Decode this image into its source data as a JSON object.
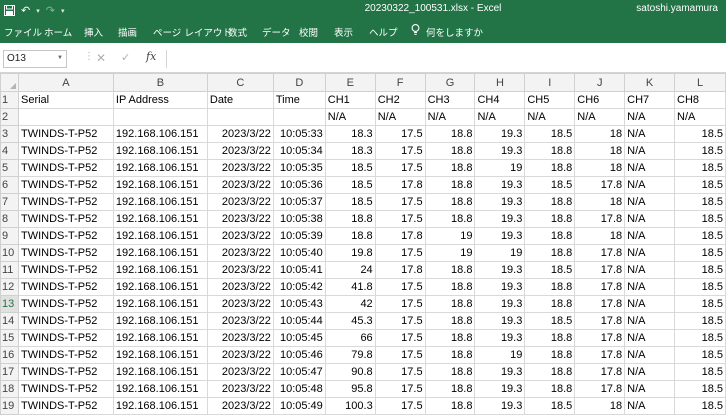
{
  "titlebar": {
    "file_title": "20230322_100531.xlsx - Excel",
    "user": "satoshi.yamamura"
  },
  "ribbon": {
    "tabs": [
      "ファイル",
      "ホーム",
      "挿入",
      "描画",
      "ページ レイアウト",
      "数式",
      "データ",
      "校閲",
      "表示",
      "ヘルプ"
    ],
    "tell_me": "何をしますか"
  },
  "formula_bar": {
    "name_box": "O13",
    "fx_label": "fx",
    "formula": ""
  },
  "sheet": {
    "active_row": "13",
    "columns": [
      "A",
      "B",
      "C",
      "D",
      "E",
      "F",
      "G",
      "H",
      "I",
      "J",
      "K",
      "L"
    ],
    "header_row": [
      "Serial",
      "IP Address",
      "Date",
      "Time",
      "CH1",
      "CH2",
      "CH3",
      "CH4",
      "CH5",
      "CH6",
      "CH7",
      "CH8"
    ],
    "unit_row": [
      "",
      "",
      "",
      "",
      "N/A",
      "N/A",
      "N/A",
      "N/A",
      "N/A",
      "N/A",
      "N/A",
      "N/A"
    ],
    "rows": [
      [
        "3",
        "TWINDS-T-P52",
        "192.168.106.151",
        "2023/3/22",
        "10:05:33",
        "18.3",
        "17.5",
        "18.8",
        "19.3",
        "18.5",
        "18",
        "N/A",
        "18.5"
      ],
      [
        "4",
        "TWINDS-T-P52",
        "192.168.106.151",
        "2023/3/22",
        "10:05:34",
        "18.3",
        "17.5",
        "18.8",
        "19.3",
        "18.8",
        "18",
        "N/A",
        "18.5"
      ],
      [
        "5",
        "TWINDS-T-P52",
        "192.168.106.151",
        "2023/3/22",
        "10:05:35",
        "18.5",
        "17.5",
        "18.8",
        "19",
        "18.8",
        "18",
        "N/A",
        "18.5"
      ],
      [
        "6",
        "TWINDS-T-P52",
        "192.168.106.151",
        "2023/3/22",
        "10:05:36",
        "18.5",
        "17.8",
        "18.8",
        "19.3",
        "18.5",
        "17.8",
        "N/A",
        "18.5"
      ],
      [
        "7",
        "TWINDS-T-P52",
        "192.168.106.151",
        "2023/3/22",
        "10:05:37",
        "18.5",
        "17.5",
        "18.8",
        "19.3",
        "18.8",
        "18",
        "N/A",
        "18.5"
      ],
      [
        "8",
        "TWINDS-T-P52",
        "192.168.106.151",
        "2023/3/22",
        "10:05:38",
        "18.8",
        "17.5",
        "18.8",
        "19.3",
        "18.8",
        "17.8",
        "N/A",
        "18.5"
      ],
      [
        "9",
        "TWINDS-T-P52",
        "192.168.106.151",
        "2023/3/22",
        "10:05:39",
        "18.8",
        "17.8",
        "19",
        "19.3",
        "18.8",
        "18",
        "N/A",
        "18.5"
      ],
      [
        "10",
        "TWINDS-T-P52",
        "192.168.106.151",
        "2023/3/22",
        "10:05:40",
        "19.8",
        "17.5",
        "19",
        "19",
        "18.8",
        "17.8",
        "N/A",
        "18.5"
      ],
      [
        "11",
        "TWINDS-T-P52",
        "192.168.106.151",
        "2023/3/22",
        "10:05:41",
        "24",
        "17.8",
        "18.8",
        "19.3",
        "18.5",
        "17.8",
        "N/A",
        "18.5"
      ],
      [
        "12",
        "TWINDS-T-P52",
        "192.168.106.151",
        "2023/3/22",
        "10:05:42",
        "41.8",
        "17.5",
        "18.8",
        "19.3",
        "18.8",
        "17.8",
        "N/A",
        "18.5"
      ],
      [
        "13",
        "TWINDS-T-P52",
        "192.168.106.151",
        "2023/3/22",
        "10:05:43",
        "42",
        "17.5",
        "18.8",
        "19.3",
        "18.8",
        "17.8",
        "N/A",
        "18.5"
      ],
      [
        "14",
        "TWINDS-T-P52",
        "192.168.106.151",
        "2023/3/22",
        "10:05:44",
        "45.3",
        "17.5",
        "18.8",
        "19.3",
        "18.5",
        "17.8",
        "N/A",
        "18.5"
      ],
      [
        "15",
        "TWINDS-T-P52",
        "192.168.106.151",
        "2023/3/22",
        "10:05:45",
        "66",
        "17.5",
        "18.8",
        "19.3",
        "18.8",
        "17.8",
        "N/A",
        "18.5"
      ],
      [
        "16",
        "TWINDS-T-P52",
        "192.168.106.151",
        "2023/3/22",
        "10:05:46",
        "79.8",
        "17.5",
        "18.8",
        "19",
        "18.8",
        "17.8",
        "N/A",
        "18.5"
      ],
      [
        "17",
        "TWINDS-T-P52",
        "192.168.106.151",
        "2023/3/22",
        "10:05:47",
        "90.8",
        "17.5",
        "18.8",
        "19.3",
        "18.8",
        "17.8",
        "N/A",
        "18.5"
      ],
      [
        "18",
        "TWINDS-T-P52",
        "192.168.106.151",
        "2023/3/22",
        "10:05:48",
        "95.8",
        "17.5",
        "18.8",
        "19.3",
        "18.8",
        "17.8",
        "N/A",
        "18.5"
      ],
      [
        "19",
        "TWINDS-T-P52",
        "192.168.106.151",
        "2023/3/22",
        "10:05:49",
        "100.3",
        "17.5",
        "18.8",
        "19.3",
        "18.5",
        "18",
        "N/A",
        "18.5"
      ]
    ]
  },
  "colors": {
    "excel_green": "#227447",
    "header_gray": "#f3f3f3",
    "gridline": "#d9d9d9"
  }
}
